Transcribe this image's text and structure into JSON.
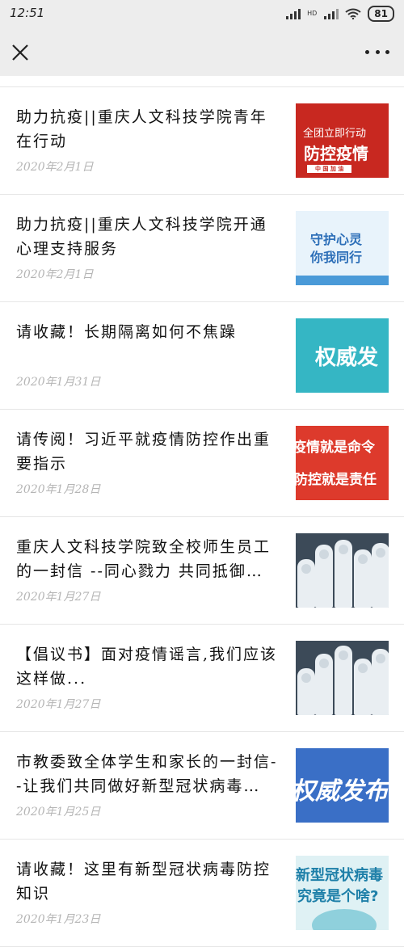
{
  "status": {
    "time": "12:51",
    "battery": "81",
    "hd": "HD"
  },
  "nav": {
    "close_icon": "close-icon",
    "more_icon": "more-icon"
  },
  "articles": [
    {
      "title": "助力抗疫||重庆人文科技学院青年在行动",
      "date": "2020年2月1日",
      "thumb": {
        "line1": "全团立即行动",
        "line2": "防控疫情",
        "line3": "中 国 加 油"
      }
    },
    {
      "title": "助力抗疫||重庆人文科技学院开通心理支持服务",
      "date": "2020年2月1日",
      "thumb": {
        "line1": "守护心灵",
        "line2": "你我同行"
      }
    },
    {
      "title": "请收藏！长期隔离如何不焦躁",
      "date": "2020年1月31日",
      "thumb": {
        "line1": "权威发"
      }
    },
    {
      "title": "请传阅！习近平就疫情防控作出重要指示",
      "date": "2020年1月28日",
      "thumb": {
        "line1": "疫情就是命令",
        "line2": "防控就是责任"
      }
    },
    {
      "title": "重庆人文科技学院致全校师生员工的一封信 --同心戮力 共同抵御新...",
      "date": "2020年1月27日",
      "thumb": {}
    },
    {
      "title": "【倡议书】面对疫情谣言,我们应该这样做...",
      "date": "2020年1月27日",
      "thumb": {}
    },
    {
      "title": "市教委致全体学生和家长的一封信--让我们共同做好新型冠状病毒感...",
      "date": "2020年1月25日",
      "thumb": {
        "line1": "权威发布"
      }
    },
    {
      "title": "请收藏！这里有新型冠状病毒防控知识",
      "date": "2020年1月23日",
      "thumb": {
        "line1": "新型冠状病毒",
        "line2": "究竟是个啥?"
      }
    }
  ]
}
